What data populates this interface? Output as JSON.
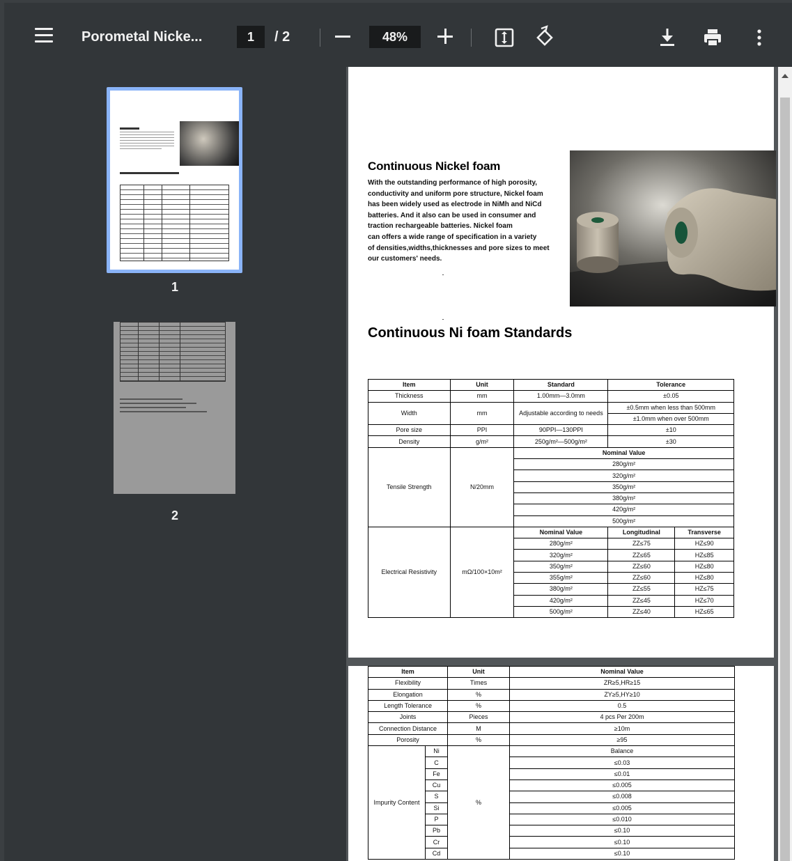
{
  "toolbar": {
    "title": "Porometal Nicke...",
    "current_page": "1",
    "page_separator": "/ 2",
    "zoom": "48%",
    "icons": {
      "menu": "hamburger-menu-icon",
      "zoom_out": "minus-icon",
      "zoom_in": "plus-icon",
      "fit": "fit-to-page-icon",
      "rotate": "rotate-counterclockwise-icon",
      "download": "download-icon",
      "print": "print-icon",
      "more": "more-vert-icon"
    }
  },
  "sidebar": {
    "thumbnails": [
      {
        "label": "1",
        "selected": true
      },
      {
        "label": "2",
        "selected": false
      }
    ]
  },
  "colors": {
    "toolbar_bg": "#323639",
    "viewer_bg": "#525659",
    "thumbnail_selected": "#8ab4f8"
  },
  "page1": {
    "heading": "Continuous Nickel foam",
    "intro_lines": [
      "With the outstanding performance of high porosity,",
      "conductivity and uniform pore structure, Nickel foam",
      "has been widely used as electrode in NiMh and NiCd",
      "batteries. And it also can be used in consumer and",
      "traction rechargeable batteries. Nickel foam",
      "can offers a wide range of specification in a variety",
      "of densities,widths,thicknesses and pore sizes to meet",
      "our customers' needs."
    ],
    "standards_heading": "Continuous Ni foam Standards",
    "table": {
      "headers": [
        "Item",
        "Unit",
        "Standard",
        "Tolerance"
      ],
      "thickness": [
        "Thickness",
        "mm",
        "1.00mm—3.0mm",
        "±0.05"
      ],
      "width": [
        "Width",
        "mm",
        "Adjustable according to needs",
        "±0.5mm when less than 500mm",
        "±1.0mm when over 500mm"
      ],
      "pore_size": [
        "Pore size",
        "PPI",
        "90PPI—130PPI",
        "±10"
      ],
      "density": [
        "Density",
        "g/m²",
        "250g/m²—500g/m²",
        "±30"
      ],
      "tensile": {
        "item": "Tensile Strength",
        "unit": "N/20mm",
        "header": "Nominal Value",
        "values": [
          "280g/m²",
          "320g/m²",
          "350g/m²",
          "380g/m²",
          "420g/m²",
          "500g/m²"
        ]
      },
      "resistivity": {
        "item": "Electrical Resistivity",
        "unit": "mΩ/100×10m²",
        "headers": [
          "Nominal Value",
          "Longitudinal",
          "Transverse"
        ],
        "rows": [
          [
            "280g/m²",
            "ZZ≤75",
            "HZ≤90"
          ],
          [
            "320g/m²",
            "ZZ≤65",
            "HZ≤85"
          ],
          [
            "350g/m²",
            "ZZ≤60",
            "HZ≤80"
          ],
          [
            "355g/m²",
            "ZZ≤60",
            "HZ≤80"
          ],
          [
            "380g/m²",
            "ZZ≤55",
            "HZ≤75"
          ],
          [
            "420g/m²",
            "ZZ≤45",
            "HZ≤70"
          ],
          [
            "500g/m²",
            "ZZ≤40",
            "HZ≤65"
          ]
        ]
      }
    }
  },
  "page2": {
    "table": {
      "headers": [
        "Item",
        "Unit",
        "Nominal Value"
      ],
      "rows": [
        [
          "Flexibility",
          "Times",
          "ZR≥5,HR≥15"
        ],
        [
          "Elongation",
          "%",
          "ZY≥5,HY≥10"
        ],
        [
          "Length Tolerance",
          "%",
          "0.5"
        ],
        [
          "Joints",
          "Pieces",
          "4 pcs Per 200m"
        ],
        [
          "Connection Distance",
          "M",
          "≥10m"
        ],
        [
          "Porosity",
          "%",
          "≥95"
        ]
      ],
      "impurity": {
        "item": "Impurity Content",
        "unit": "%",
        "rows": [
          [
            "Ni",
            "Balance"
          ],
          [
            "C",
            "≤0.03"
          ],
          [
            "Fe",
            "≤0.01"
          ],
          [
            "Cu",
            "≤0.005"
          ],
          [
            "S",
            "≤0.008"
          ],
          [
            "Si",
            "≤0.005"
          ],
          [
            "P",
            "≤0.010"
          ],
          [
            "Pb",
            "≤0.10"
          ],
          [
            "Cr",
            "≤0.10"
          ],
          [
            "Cd",
            "≤0.10"
          ]
        ]
      }
    }
  }
}
